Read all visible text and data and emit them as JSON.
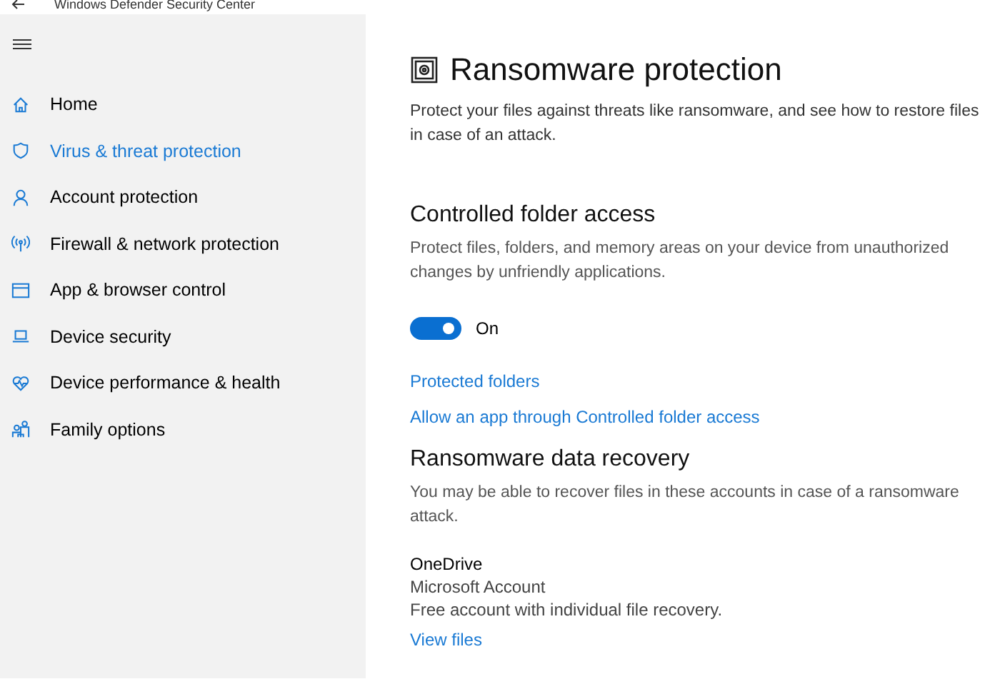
{
  "window": {
    "title": "Windows Defender Security Center"
  },
  "sidebar": {
    "items": [
      {
        "label": "Home",
        "selected": false
      },
      {
        "label": "Virus & threat protection",
        "selected": true
      },
      {
        "label": "Account protection",
        "selected": false
      },
      {
        "label": "Firewall & network protection",
        "selected": false
      },
      {
        "label": "App & browser control",
        "selected": false
      },
      {
        "label": "Device security",
        "selected": false
      },
      {
        "label": "Device performance & health",
        "selected": false
      },
      {
        "label": "Family options",
        "selected": false
      }
    ]
  },
  "page": {
    "title": "Ransomware protection",
    "description": "Protect your files against threats like ransomware, and see how to restore files in case of an attack."
  },
  "controlled_folder_access": {
    "heading": "Controlled folder access",
    "description": "Protect files, folders, and memory areas on your device from unauthorized changes by unfriendly applications.",
    "toggle": {
      "on": true,
      "label": "On"
    },
    "links": [
      "Protected folders",
      "Allow an app through Controlled folder access"
    ]
  },
  "data_recovery": {
    "heading": "Ransomware data recovery",
    "description": "You may be able to recover files in these accounts in case of a ransomware attack.",
    "account": {
      "name": "OneDrive",
      "type": "Microsoft Account",
      "plan": "Free account with individual file recovery."
    },
    "link": "View files"
  }
}
